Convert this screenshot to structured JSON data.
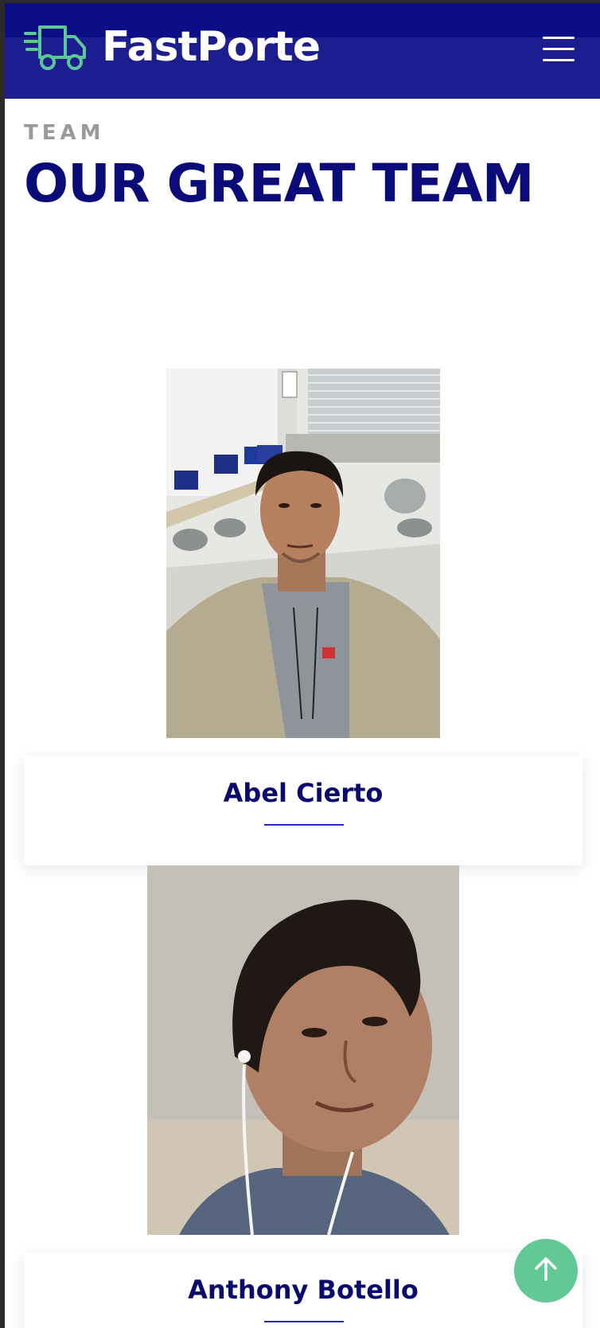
{
  "header": {
    "brand": "FastPorte",
    "logo_icon": "delivery-truck-icon",
    "menu_icon": "hamburger-menu-icon",
    "colors": {
      "navbar": "#1c1d8f",
      "logo_accent": "#5cc897"
    }
  },
  "team_section": {
    "kicker": "TEAM",
    "title": "OUR GREAT TEAM",
    "members": [
      {
        "name": "Abel Cierto"
      },
      {
        "name": "Anthony Botello"
      }
    ]
  },
  "scroll_top": {
    "icon": "arrow-up-icon",
    "color": "#63c994"
  }
}
